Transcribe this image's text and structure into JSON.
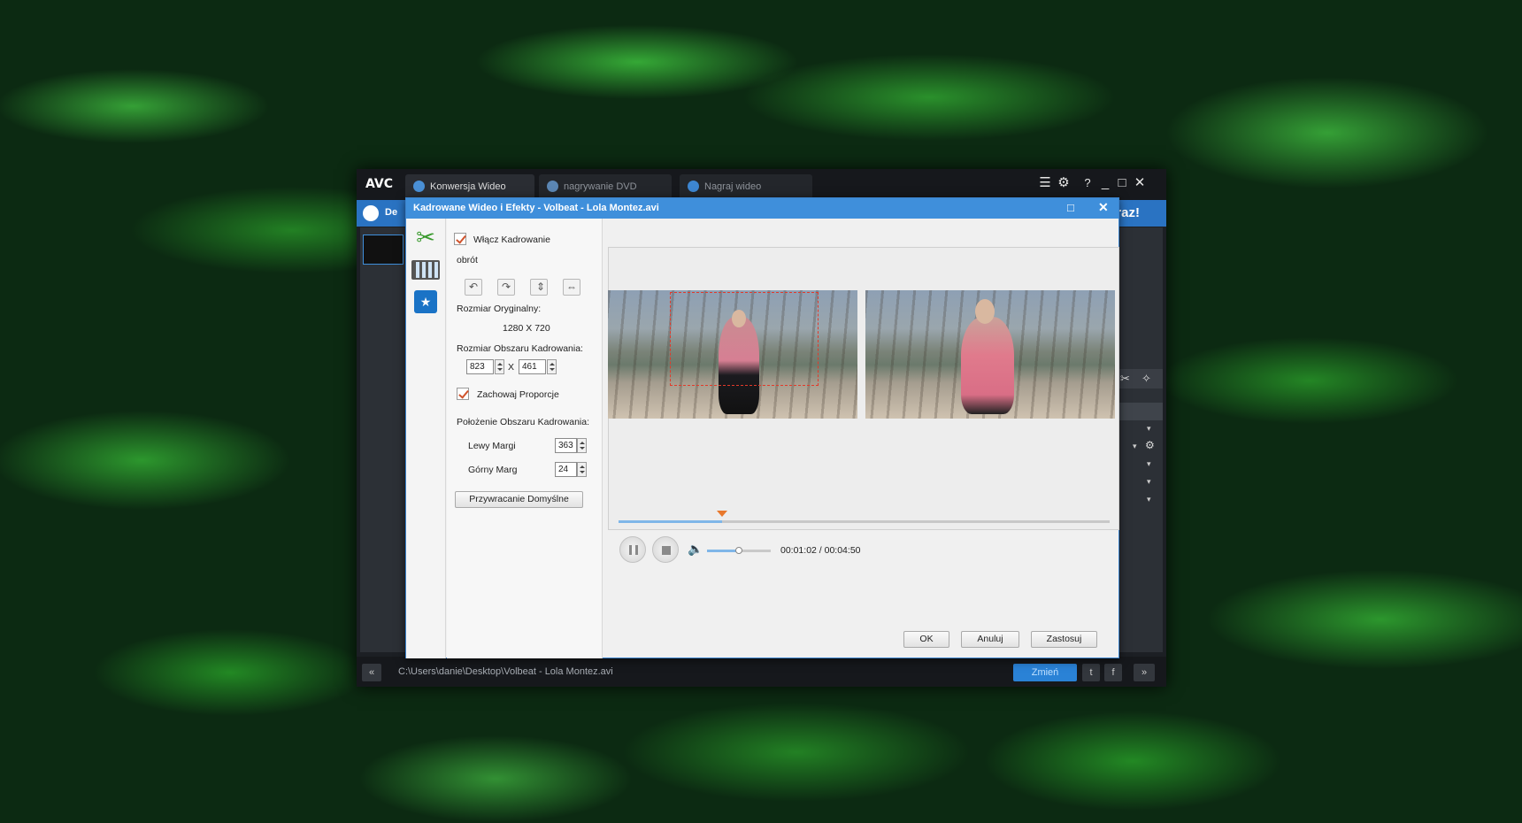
{
  "app": {
    "logo": "AVC",
    "big_button": "teraz!",
    "app_label_fragment": "De"
  },
  "tabs": [
    {
      "label": "Konwersja Wideo"
    },
    {
      "label": "nagrywanie DVD"
    },
    {
      "label": "Nagraj wideo"
    }
  ],
  "dialog": {
    "title": "Kadrowane Wideo i Efekty - Volbeat - Lola Montez.avi",
    "enable_crop": "Włącz Kadrowanie",
    "rotation": "obrót",
    "original_size_label": "Rozmiar Oryginalny:",
    "original_size_value": "1280 X 720",
    "crop_area_size_label": "Rozmiar Obszaru Kadrowania:",
    "crop_width": "823",
    "crop_x": "X",
    "crop_height": "461",
    "keep_ratio": "Zachowaj Proporcje",
    "crop_position_label": "Położenie Obszaru Kadrowania:",
    "left_margin_label": "Lewy Margi",
    "left_margin": "363",
    "top_margin_label": "Górny Marg",
    "top_margin": "24",
    "restore_defaults": "Przywracanie Domyślne",
    "time": "00:01:02 / 00:04:50",
    "progress": 0.21,
    "volume": 0.5,
    "ok": "OK",
    "cancel": "Anuluj",
    "apply": "Zastosuj"
  },
  "statusbar": {
    "path": "C:\\Users\\danie\\Desktop\\Volbeat - Lola Montez.avi",
    "upgrade": "Zmień"
  },
  "colors": {
    "accent": "#3f8fdb",
    "crop_marker": "#e8782c",
    "checkmark": "#d0532c"
  }
}
